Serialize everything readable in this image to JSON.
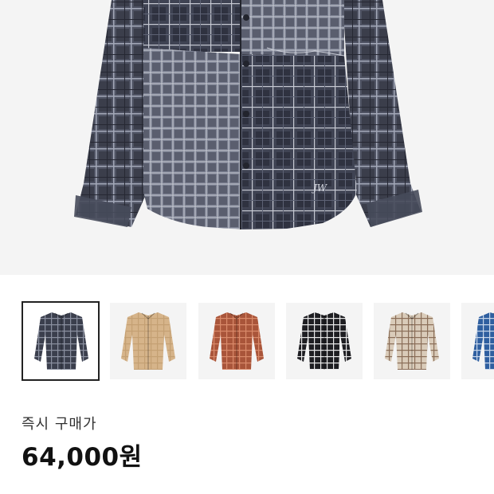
{
  "product": {
    "main_image": "plaid-patchwork-shirt",
    "logo_mark": "JW"
  },
  "thumbnails": [
    {
      "name": "navy-patchwork-plaid-shirt",
      "base": "#3b3f4d",
      "line": "#8b90a0",
      "selected": true
    },
    {
      "name": "beige-shirt",
      "base": "#d6b48a",
      "line": "#c4a073",
      "selected": false
    },
    {
      "name": "rust-plaid-shirt",
      "base": "#a9553a",
      "line": "#d98a6a",
      "selected": false
    },
    {
      "name": "black-white-plaid-shirt",
      "base": "#1e1e22",
      "line": "#e9e9e9",
      "selected": false
    },
    {
      "name": "cream-brown-plaid-shirt",
      "base": "#d9cbb9",
      "line": "#8a6e58",
      "selected": false
    },
    {
      "name": "blue-plaid-shirt",
      "base": "#2f5fa0",
      "line": "#c7d6ea",
      "selected": false
    }
  ],
  "purchase": {
    "label": "즉시 구매가",
    "price": "64,000원"
  }
}
